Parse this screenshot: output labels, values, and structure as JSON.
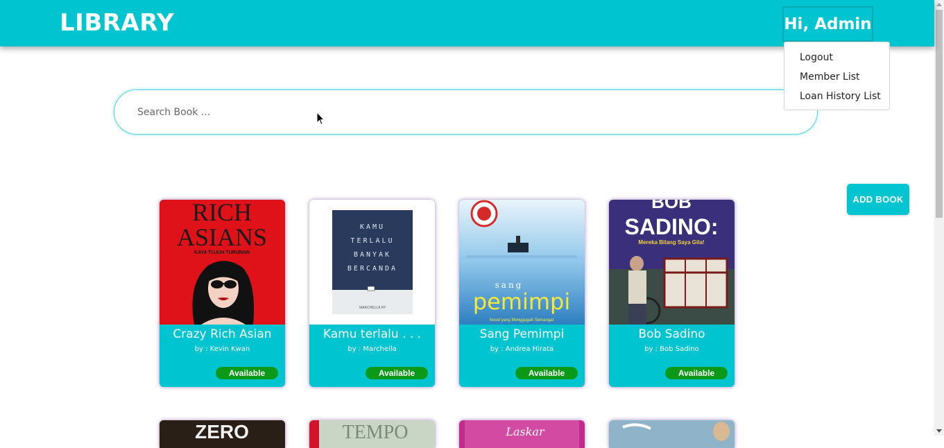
{
  "header": {
    "brand": "LIBRARY",
    "user_greeting": "Hi, Admin"
  },
  "user_menu": {
    "items": [
      "Logout",
      "Member List",
      "Loan History List"
    ]
  },
  "search": {
    "placeholder": "Search Book ...",
    "value": ""
  },
  "actions": {
    "add_book_label": "ADD BOOK"
  },
  "books": [
    {
      "title": "Crazy Rich Asian",
      "author": "by : Kevin Kwan",
      "status": "Available"
    },
    {
      "title": "Kamu terlalu . . .",
      "author": "by : Marchella",
      "status": "Available"
    },
    {
      "title": "Sang Pemimpi",
      "author": "by : Andrea Hirata",
      "status": "Available"
    },
    {
      "title": "Bob Sadino",
      "author": "by : Bob Sadino",
      "status": "Available"
    }
  ],
  "covers": {
    "crazy_rich": {
      "line1": "RICH",
      "line2": "ASIANS",
      "line3": "KAYA TUJUH TURUNAN"
    },
    "kamu": {
      "line1": "KAMU",
      "line2": "TERLALU",
      "line3": "BANYAK",
      "line4": "BERCANDA",
      "author": "MARCHELLA FP"
    },
    "pemimpi": {
      "small": "sang",
      "big": "pemimpi",
      "tag": "Novel yang Menggugah Semangat"
    },
    "bob": {
      "line1": "BOB",
      "line2": "SADINO:",
      "subtitle": "Mereka Bilang Saya Gila!"
    },
    "row2": [
      "ZERO",
      "TEMPO",
      "Laskar"
    ]
  },
  "colors": {
    "primary": "#00c5d0",
    "available": "#0a9a18"
  }
}
